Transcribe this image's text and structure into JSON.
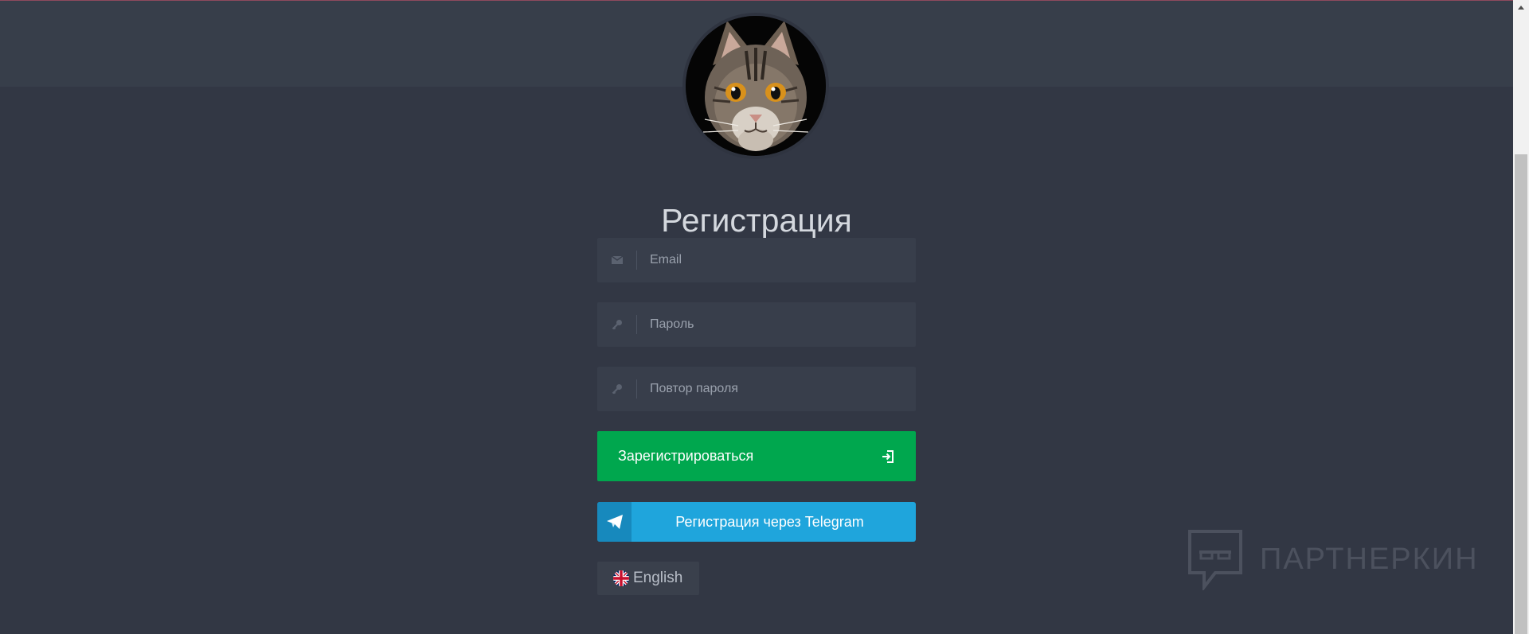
{
  "page": {
    "title": "Регистрация"
  },
  "form": {
    "email": {
      "placeholder": "Email",
      "icon": "envelope-icon"
    },
    "password": {
      "placeholder": "Пароль",
      "icon": "key-icon"
    },
    "password_repeat": {
      "placeholder": "Повтор пароля",
      "icon": "key-icon"
    },
    "submit_label": "Зарегистрироваться",
    "submit_icon": "sign-in-icon"
  },
  "telegram": {
    "label": "Регистрация через Telegram",
    "icon": "paper-plane-icon"
  },
  "language": {
    "label": "English",
    "icon": "uk-flag-icon"
  },
  "watermark": {
    "text": "ПАРТНЕРКИН"
  },
  "colors": {
    "background": "#323744",
    "header_band": "#373e4a",
    "input_bg": "#383e4b",
    "register_button": "#00a74e",
    "telegram_button": "#1fa5dc",
    "telegram_icon_box": "#1789bd",
    "title_text": "#d4d8de"
  }
}
